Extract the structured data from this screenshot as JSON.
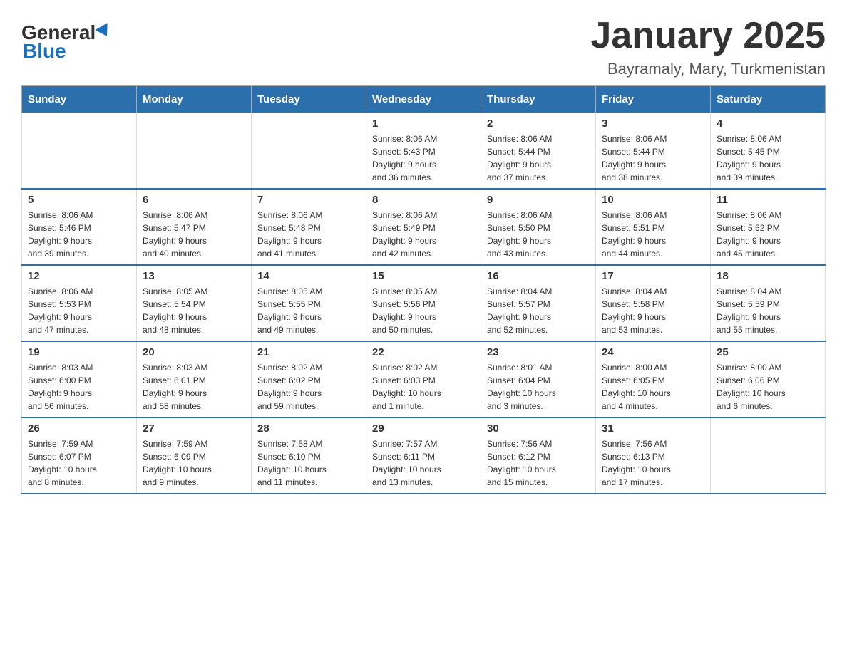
{
  "logo": {
    "general": "General",
    "blue": "Blue"
  },
  "title": "January 2025",
  "subtitle": "Bayramaly, Mary, Turkmenistan",
  "days_of_week": [
    "Sunday",
    "Monday",
    "Tuesday",
    "Wednesday",
    "Thursday",
    "Friday",
    "Saturday"
  ],
  "weeks": [
    [
      {
        "day": "",
        "info": ""
      },
      {
        "day": "",
        "info": ""
      },
      {
        "day": "",
        "info": ""
      },
      {
        "day": "1",
        "info": "Sunrise: 8:06 AM\nSunset: 5:43 PM\nDaylight: 9 hours\nand 36 minutes."
      },
      {
        "day": "2",
        "info": "Sunrise: 8:06 AM\nSunset: 5:44 PM\nDaylight: 9 hours\nand 37 minutes."
      },
      {
        "day": "3",
        "info": "Sunrise: 8:06 AM\nSunset: 5:44 PM\nDaylight: 9 hours\nand 38 minutes."
      },
      {
        "day": "4",
        "info": "Sunrise: 8:06 AM\nSunset: 5:45 PM\nDaylight: 9 hours\nand 39 minutes."
      }
    ],
    [
      {
        "day": "5",
        "info": "Sunrise: 8:06 AM\nSunset: 5:46 PM\nDaylight: 9 hours\nand 39 minutes."
      },
      {
        "day": "6",
        "info": "Sunrise: 8:06 AM\nSunset: 5:47 PM\nDaylight: 9 hours\nand 40 minutes."
      },
      {
        "day": "7",
        "info": "Sunrise: 8:06 AM\nSunset: 5:48 PM\nDaylight: 9 hours\nand 41 minutes."
      },
      {
        "day": "8",
        "info": "Sunrise: 8:06 AM\nSunset: 5:49 PM\nDaylight: 9 hours\nand 42 minutes."
      },
      {
        "day": "9",
        "info": "Sunrise: 8:06 AM\nSunset: 5:50 PM\nDaylight: 9 hours\nand 43 minutes."
      },
      {
        "day": "10",
        "info": "Sunrise: 8:06 AM\nSunset: 5:51 PM\nDaylight: 9 hours\nand 44 minutes."
      },
      {
        "day": "11",
        "info": "Sunrise: 8:06 AM\nSunset: 5:52 PM\nDaylight: 9 hours\nand 45 minutes."
      }
    ],
    [
      {
        "day": "12",
        "info": "Sunrise: 8:06 AM\nSunset: 5:53 PM\nDaylight: 9 hours\nand 47 minutes."
      },
      {
        "day": "13",
        "info": "Sunrise: 8:05 AM\nSunset: 5:54 PM\nDaylight: 9 hours\nand 48 minutes."
      },
      {
        "day": "14",
        "info": "Sunrise: 8:05 AM\nSunset: 5:55 PM\nDaylight: 9 hours\nand 49 minutes."
      },
      {
        "day": "15",
        "info": "Sunrise: 8:05 AM\nSunset: 5:56 PM\nDaylight: 9 hours\nand 50 minutes."
      },
      {
        "day": "16",
        "info": "Sunrise: 8:04 AM\nSunset: 5:57 PM\nDaylight: 9 hours\nand 52 minutes."
      },
      {
        "day": "17",
        "info": "Sunrise: 8:04 AM\nSunset: 5:58 PM\nDaylight: 9 hours\nand 53 minutes."
      },
      {
        "day": "18",
        "info": "Sunrise: 8:04 AM\nSunset: 5:59 PM\nDaylight: 9 hours\nand 55 minutes."
      }
    ],
    [
      {
        "day": "19",
        "info": "Sunrise: 8:03 AM\nSunset: 6:00 PM\nDaylight: 9 hours\nand 56 minutes."
      },
      {
        "day": "20",
        "info": "Sunrise: 8:03 AM\nSunset: 6:01 PM\nDaylight: 9 hours\nand 58 minutes."
      },
      {
        "day": "21",
        "info": "Sunrise: 8:02 AM\nSunset: 6:02 PM\nDaylight: 9 hours\nand 59 minutes."
      },
      {
        "day": "22",
        "info": "Sunrise: 8:02 AM\nSunset: 6:03 PM\nDaylight: 10 hours\nand 1 minute."
      },
      {
        "day": "23",
        "info": "Sunrise: 8:01 AM\nSunset: 6:04 PM\nDaylight: 10 hours\nand 3 minutes."
      },
      {
        "day": "24",
        "info": "Sunrise: 8:00 AM\nSunset: 6:05 PM\nDaylight: 10 hours\nand 4 minutes."
      },
      {
        "day": "25",
        "info": "Sunrise: 8:00 AM\nSunset: 6:06 PM\nDaylight: 10 hours\nand 6 minutes."
      }
    ],
    [
      {
        "day": "26",
        "info": "Sunrise: 7:59 AM\nSunset: 6:07 PM\nDaylight: 10 hours\nand 8 minutes."
      },
      {
        "day": "27",
        "info": "Sunrise: 7:59 AM\nSunset: 6:09 PM\nDaylight: 10 hours\nand 9 minutes."
      },
      {
        "day": "28",
        "info": "Sunrise: 7:58 AM\nSunset: 6:10 PM\nDaylight: 10 hours\nand 11 minutes."
      },
      {
        "day": "29",
        "info": "Sunrise: 7:57 AM\nSunset: 6:11 PM\nDaylight: 10 hours\nand 13 minutes."
      },
      {
        "day": "30",
        "info": "Sunrise: 7:56 AM\nSunset: 6:12 PM\nDaylight: 10 hours\nand 15 minutes."
      },
      {
        "day": "31",
        "info": "Sunrise: 7:56 AM\nSunset: 6:13 PM\nDaylight: 10 hours\nand 17 minutes."
      },
      {
        "day": "",
        "info": ""
      }
    ]
  ]
}
